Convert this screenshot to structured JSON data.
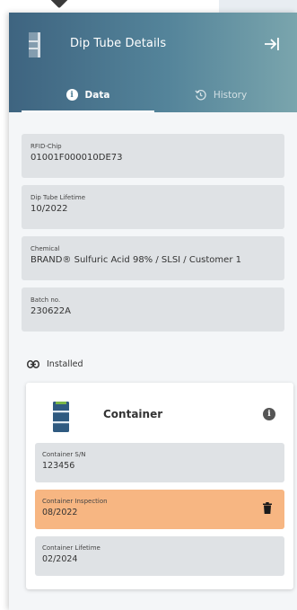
{
  "header": {
    "title": "Dip Tube Details",
    "tabs": [
      {
        "label": "Data",
        "active": true
      },
      {
        "label": "History",
        "active": false
      }
    ]
  },
  "fields": [
    {
      "label": "RFID-Chip",
      "value": "01001F000010DE73"
    },
    {
      "label": "Dip Tube Lifetime",
      "value": "10/2022"
    },
    {
      "label": "Chemical",
      "value": "BRAND® Sulfuric Acid 98% / SLSI / Customer 1"
    },
    {
      "label": "Batch no.",
      "value": "230622A"
    }
  ],
  "installed": {
    "label": "Installed"
  },
  "container": {
    "title": "Container",
    "fields": [
      {
        "label": "Container S/N",
        "value": "123456"
      },
      {
        "label": "Container Inspection",
        "value": "08/2022",
        "status": "warning"
      },
      {
        "label": "Container Lifetime",
        "value": "02/2024"
      }
    ]
  },
  "colors": {
    "header_start": "#3e6480",
    "header_end": "#7aa5ad",
    "warning": "#f7b682",
    "field_bg": "#dfe2e5",
    "barrel": "#2f5a80",
    "barrel_band": "#7ab648"
  },
  "icons": [
    "dip-tube-icon",
    "collapse-panel-icon",
    "info-icon",
    "history-icon",
    "link-icon",
    "barrel-icon",
    "trash-icon"
  ]
}
